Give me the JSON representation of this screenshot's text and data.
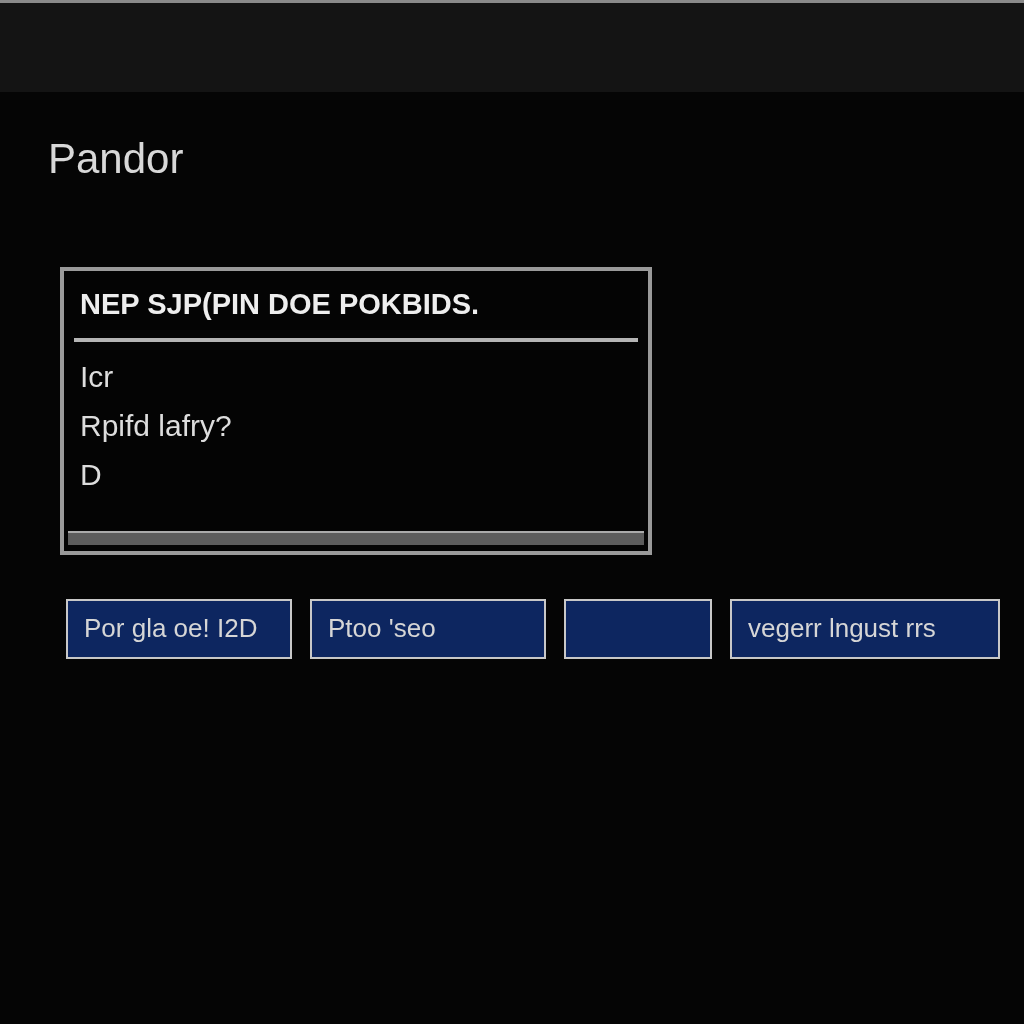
{
  "window": {
    "title": "Pandor"
  },
  "dialog": {
    "heading": "NEP SJP(PIN DOE POKBIDS.",
    "lines": [
      "Icr",
      "Rpifd lafry?",
      "D"
    ]
  },
  "buttons": [
    {
      "kind": "text",
      "label": "Por gla oe! I2D"
    },
    {
      "kind": "text",
      "label": "Ptoo 'seo"
    },
    {
      "kind": "blank"
    },
    {
      "kind": "text",
      "label": "vegerr lngust rrs"
    }
  ]
}
